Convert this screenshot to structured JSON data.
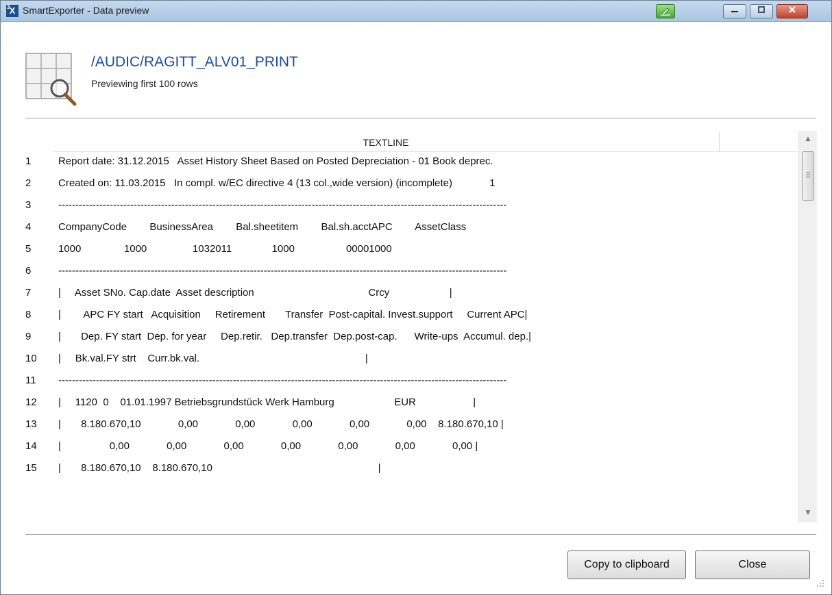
{
  "window": {
    "title": "SmartExporter - Data preview",
    "app_icon_letter": "X",
    "app_icon_sup": "3",
    "pen_icon": "pen-edit-icon",
    "min_icon": "minimize-icon",
    "max_icon": "maximize-icon",
    "close_icon": "close-icon"
  },
  "header": {
    "report_name": "/AUDIC/RAGITT_ALV01_PRINT",
    "subtitle": "Previewing first 100 rows",
    "icon": "table-search-icon"
  },
  "grid": {
    "column_header": "TEXTLINE",
    "rows": [
      {
        "num": "1",
        "text": "Report date: 31.12.2015   Asset History Sheet Based on Posted Depreciation - 01 Book deprec."
      },
      {
        "num": "2",
        "text": "Created on: 11.03.2015   In compl. w/EC directive 4 (13 col.,wide version) (incomplete)             1"
      },
      {
        "num": "3",
        "text": "-----------------------------------------------------------------------------------------------------------------------------------"
      },
      {
        "num": "4",
        "text": "CompanyCode        BusinessArea        Bal.sheetitem        Bal.sh.acctAPC        AssetClass"
      },
      {
        "num": "5",
        "text": "1000               1000                1032011              1000                  00001000"
      },
      {
        "num": "6",
        "text": "-----------------------------------------------------------------------------------------------------------------------------------"
      },
      {
        "num": "7",
        "text": "|     Asset SNo. Cap.date  Asset description                                        Crcy                     |"
      },
      {
        "num": "8",
        "text": "|        APC FY start   Acquisition     Retirement       Transfer  Post-capital. Invest.support     Current APC|"
      },
      {
        "num": "9",
        "text": "|       Dep. FY start  Dep. for year     Dep.retir.   Dep.transfer  Dep.post-cap.      Write-ups  Accumul. dep.|"
      },
      {
        "num": "10",
        "text": "|     Bk.val.FY strt    Curr.bk.val.                                                          |"
      },
      {
        "num": "11",
        "text": "-----------------------------------------------------------------------------------------------------------------------------------"
      },
      {
        "num": "12",
        "text": "|     1120  0    01.01.1997 Betriebsgrundstück Werk Hamburg                     EUR                    |"
      },
      {
        "num": "13",
        "text": "|       8.180.670,10             0,00             0,00             0,00             0,00             0,00    8.180.670,10 |"
      },
      {
        "num": "14",
        "text": "|                 0,00             0,00             0,00             0,00             0,00             0,00             0,00 |"
      },
      {
        "num": "15",
        "text": "|       8.180.670,10    8.180.670,10                                                          |"
      }
    ]
  },
  "buttons": {
    "copy_label": "Copy to clipboard",
    "close_label": "Close"
  }
}
